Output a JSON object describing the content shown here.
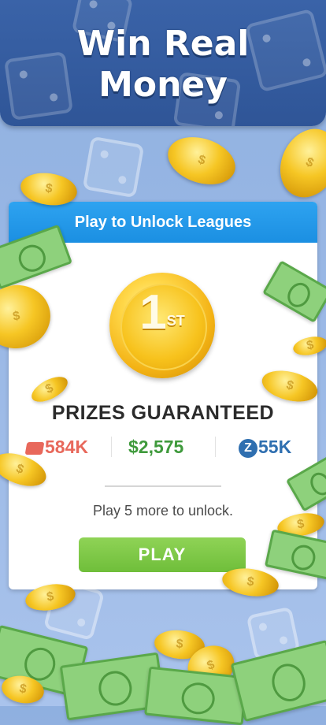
{
  "header": {
    "title_line1": "Win Real",
    "title_line2": "Money"
  },
  "card": {
    "header_label": "Play to Unlock Leagues",
    "medal": {
      "rank": "1",
      "suffix": "ST"
    },
    "prizes_title": "PRIZES GUARANTEED",
    "stats": {
      "tickets": "584K",
      "cash": "$2,575",
      "z_icon_letter": "Z",
      "z_value": "55K"
    },
    "unlock_text": "Play 5 more to unlock.",
    "play_label": "PLAY"
  },
  "colors": {
    "header_bg": "#2f5597",
    "card_header_bg": "#1b8fe2",
    "play_button": "#6fbe3a",
    "tickets": "#e8685b",
    "cash": "#3f9a3c",
    "z": "#2f6fb0"
  },
  "icons": [
    "ticket-icon",
    "z-coin-icon",
    "gold-coin-icon",
    "dollar-bill-icon",
    "dice-icon"
  ]
}
